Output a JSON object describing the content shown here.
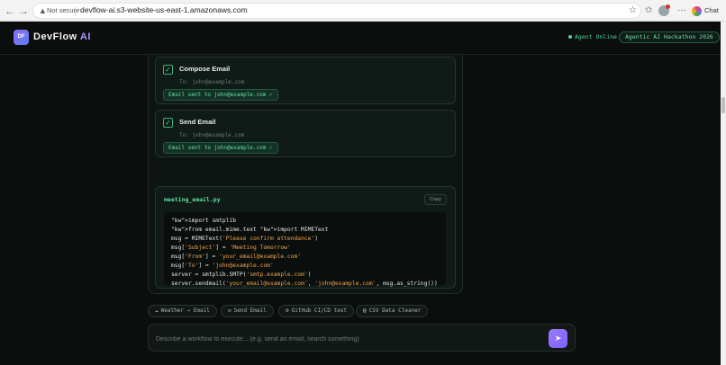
{
  "browser": {
    "back_icon": "back-arrow-icon",
    "forward_icon": "forward-arrow-icon",
    "reload_icon": "reload-icon",
    "security_label": "Not secure",
    "url": "devflow-ai.s3-website-us-east-1.amazonaws.com",
    "chat_label": "Chat"
  },
  "header": {
    "logo_initials": "DF",
    "brand_name": "DevFlow",
    "brand_suffix": "AI",
    "status": "Agent Online",
    "event_badge": "Agentic AI Hackathon 2026",
    "status_color": "#4fd39b",
    "accent_color": "#a995ff"
  },
  "steps": [
    {
      "title": "Compose Email",
      "to": "To: john@example.com",
      "result": "Email sent to john@example.com ✓",
      "done": true
    },
    {
      "title": "Send Email",
      "to": "To: john@example.com",
      "result": "Email sent to john@example.com ✓",
      "done": true
    }
  ],
  "code": {
    "filename": "meeting_email.py",
    "copy_label": "Copy",
    "lines": [
      {
        "pre": "\"kw\">import smtplib",
        "str": "",
        "post": ""
      },
      {
        "pre": "\"kw\">from email.mime.text \"kw\">import MIMEText",
        "str": "",
        "post": ""
      },
      {
        "pre": "msg = MIMEText(",
        "str": "'Please confirm attendance'",
        "post": ")"
      },
      {
        "pre": "msg[",
        "str": "'Subject'",
        "post": "] = ",
        "str2": "'Meeting Tomorrow'"
      },
      {
        "pre": "msg[",
        "str": "'From'",
        "post": "] = ",
        "str2": "'your_email@example.com'"
      },
      {
        "pre": "msg[",
        "str": "'To'",
        "post": "] = ",
        "str2": "'john@example.com'"
      },
      {
        "pre": "server = smtplib.SMTP(",
        "str": "'smtp.example.com'",
        "post": ")"
      },
      {
        "pre": "server.sendmail(",
        "str": "'your_email@example.com'",
        "post": ", ",
        "str2": "'john@example.com'",
        "post2": ", msg.as_string())"
      }
    ]
  },
  "chips": [
    {
      "label": "Weather → Email",
      "icon": "cloud-icon"
    },
    {
      "label": "Send Email",
      "icon": "mail-icon"
    },
    {
      "label": "GitHub CI/CD test",
      "icon": "gear-icon"
    },
    {
      "label": "CSV Data Cleaner",
      "icon": "document-icon"
    }
  ],
  "composer": {
    "placeholder": "Describe a workflow to execute... (e.g. send an email, search something)",
    "send_icon": "send-arrow-icon"
  }
}
